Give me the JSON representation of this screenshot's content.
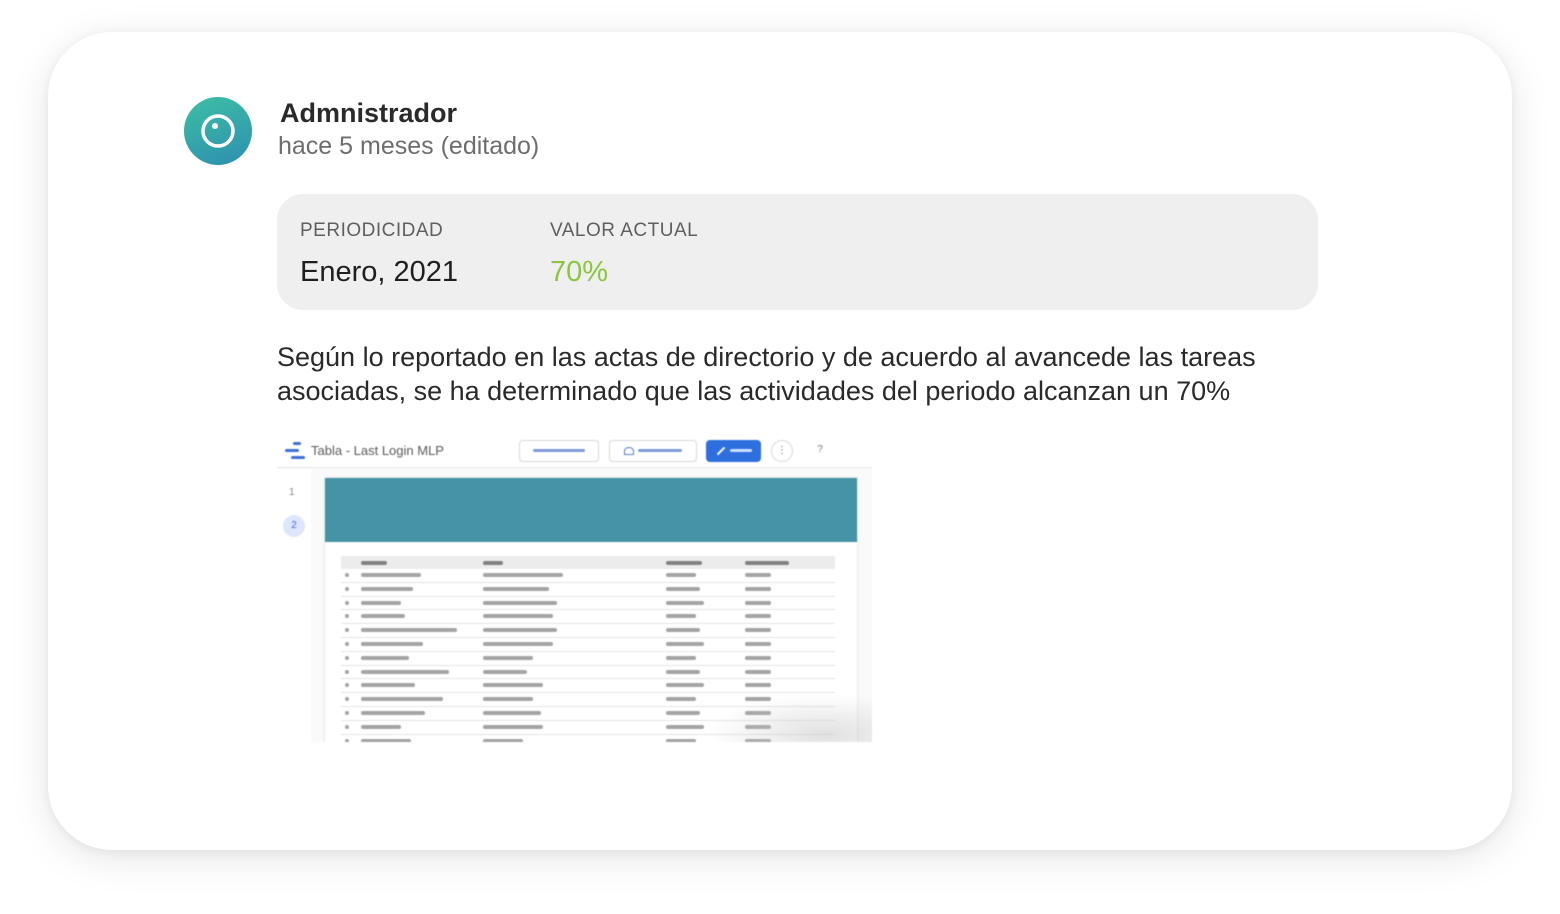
{
  "post": {
    "author": "Admnistrador",
    "timestamp": "hace 5 meses (editado)",
    "avatar_icon": "circle-dot-icon",
    "info": {
      "period_label": "PERIODICIDAD",
      "period_value": "Enero, 2021",
      "value_label": "VALOR ACTUAL",
      "value_value": "70%",
      "value_color": "#8cc63f"
    },
    "body": "Según lo reportado en las actas de directorio y de acuerdo al avancede las tareas asociadas, se ha determinado que las actividades del periodo alcanzan un 70%"
  },
  "attachment": {
    "title": "Tabla - Last Login MLP",
    "page_numbers": [
      "1",
      "2"
    ],
    "banner_color": "#4593a6",
    "icons": [
      "report-logo-icon",
      "share-icon",
      "edit-icon",
      "more-icon",
      "help-icon"
    ]
  }
}
